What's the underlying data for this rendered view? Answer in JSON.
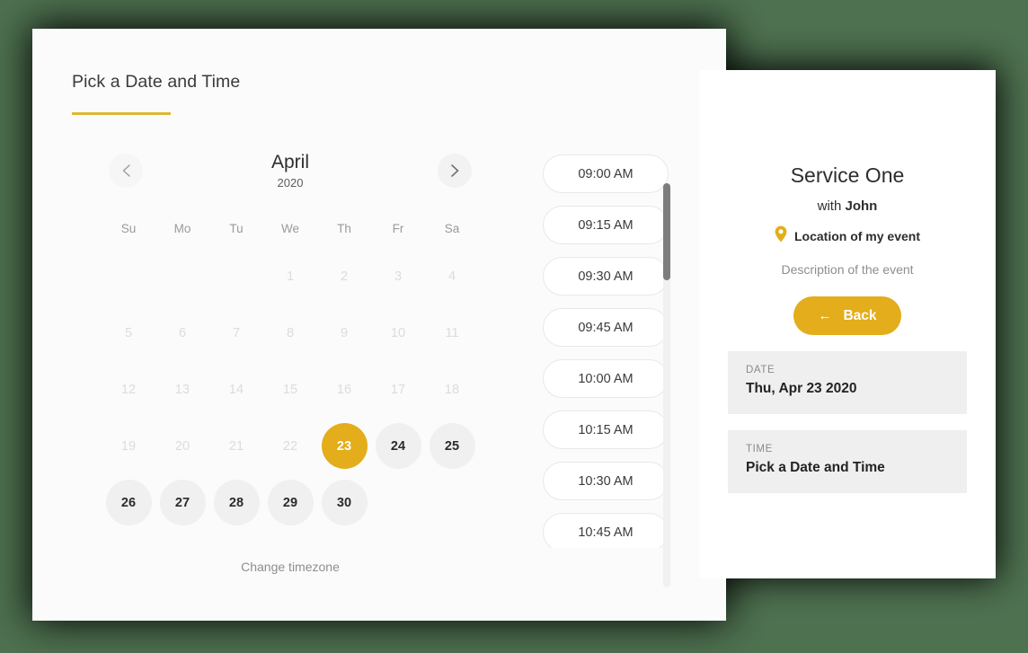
{
  "theme": {
    "accent": "#e3ad1b",
    "page_background": "#4e7150",
    "card_background": "#fbfbfb",
    "panel_background": "#ffffff",
    "info_box_background": "#efefef"
  },
  "page": {
    "title": "Pick a Date and Time"
  },
  "calendar": {
    "prev_icon": "chevron-left-icon",
    "next_icon": "chevron-right-icon",
    "month": "April",
    "year": "2020",
    "weekdays": [
      "Su",
      "Mo",
      "Tu",
      "We",
      "Th",
      "Fr",
      "Sa"
    ],
    "leading_blanks": 3,
    "days": [
      {
        "label": "1",
        "state": "disabled"
      },
      {
        "label": "2",
        "state": "disabled"
      },
      {
        "label": "3",
        "state": "disabled"
      },
      {
        "label": "4",
        "state": "disabled"
      },
      {
        "label": "5",
        "state": "disabled"
      },
      {
        "label": "6",
        "state": "disabled"
      },
      {
        "label": "7",
        "state": "disabled"
      },
      {
        "label": "8",
        "state": "disabled"
      },
      {
        "label": "9",
        "state": "disabled"
      },
      {
        "label": "10",
        "state": "disabled"
      },
      {
        "label": "11",
        "state": "disabled"
      },
      {
        "label": "12",
        "state": "disabled"
      },
      {
        "label": "13",
        "state": "disabled"
      },
      {
        "label": "14",
        "state": "disabled"
      },
      {
        "label": "15",
        "state": "disabled"
      },
      {
        "label": "16",
        "state": "disabled"
      },
      {
        "label": "17",
        "state": "disabled"
      },
      {
        "label": "18",
        "state": "disabled"
      },
      {
        "label": "19",
        "state": "disabled"
      },
      {
        "label": "20",
        "state": "disabled"
      },
      {
        "label": "21",
        "state": "disabled"
      },
      {
        "label": "22",
        "state": "disabled"
      },
      {
        "label": "23",
        "state": "selected"
      },
      {
        "label": "24",
        "state": "available"
      },
      {
        "label": "25",
        "state": "available"
      },
      {
        "label": "26",
        "state": "available"
      },
      {
        "label": "27",
        "state": "available"
      },
      {
        "label": "28",
        "state": "available"
      },
      {
        "label": "29",
        "state": "available"
      },
      {
        "label": "30",
        "state": "available"
      }
    ],
    "timezone_link": "Change timezone"
  },
  "time_slots": {
    "slots": [
      "09:00 AM",
      "09:15 AM",
      "09:30 AM",
      "09:45 AM",
      "10:00 AM",
      "10:15 AM",
      "10:30 AM",
      "10:45 AM"
    ]
  },
  "summary": {
    "service_title": "Service One",
    "with_prefix": "with",
    "provider": "John",
    "location_icon": "map-pin-icon",
    "location": "Location of my event",
    "description": "Description of the event",
    "back_button": {
      "icon": "arrow-left-icon",
      "label": "Back"
    },
    "date_box": {
      "label": "DATE",
      "value": "Thu, Apr 23 2020"
    },
    "time_box": {
      "label": "TIME",
      "value": "Pick a Date and Time"
    }
  }
}
